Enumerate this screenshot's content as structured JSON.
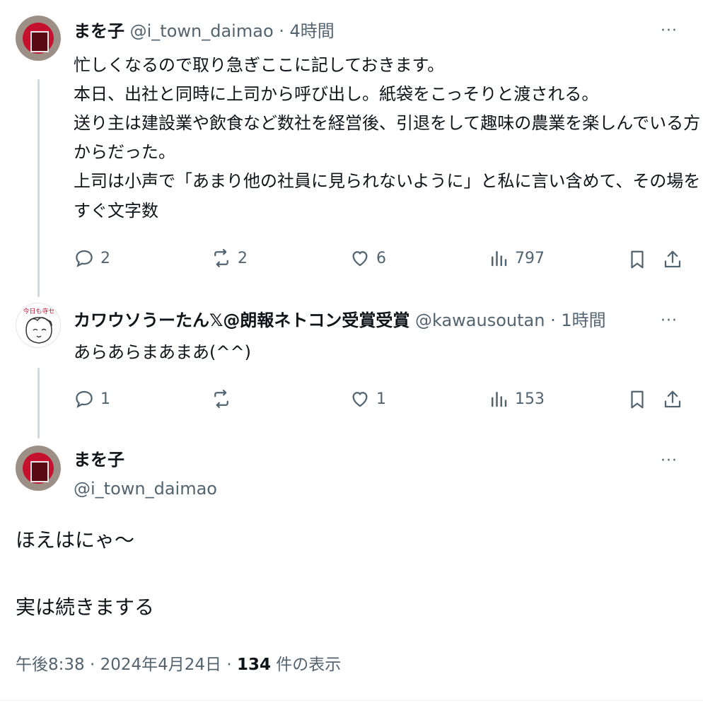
{
  "tweets": [
    {
      "name": "まを子",
      "handle": "@i_town_daimao",
      "time": "· 4時間",
      "lines": [
        "忙しくなるので取り急ぎここに記しておきます。",
        "本日、出社と同時に上司から呼び出し。紙袋をこっそりと渡される。",
        "送り主は建設業や飲食など数社を経営後、引退をして趣味の農業を楽しんでいる方",
        "からだった。",
        "上司は小声で「あまり他の社員に見られないように」と私に言い含めて、その場を",
        "すぐ文字数"
      ],
      "replies": "2",
      "retweets": "2",
      "likes": "6",
      "views": "797"
    },
    {
      "name": "カワウソうーたん𝕏@朗報ネトコン受賞受賞",
      "handle": "@kawausoutan",
      "time": "· 1時間",
      "avatar_text": "今日も寺セ",
      "lines": [
        "あらあらまあまあ(^^)"
      ],
      "replies": "1",
      "retweets": "",
      "likes": "1",
      "views": "153"
    }
  ],
  "main_tweet": {
    "name": "まを子",
    "handle": "@i_town_daimao",
    "line1": "ほえはにゃ〜",
    "line2": "実は続きまする",
    "time": "午後8:38 · 2024年4月24日 · ",
    "views_count": "134",
    "views_label": " 件の表示"
  },
  "more_label": "···"
}
